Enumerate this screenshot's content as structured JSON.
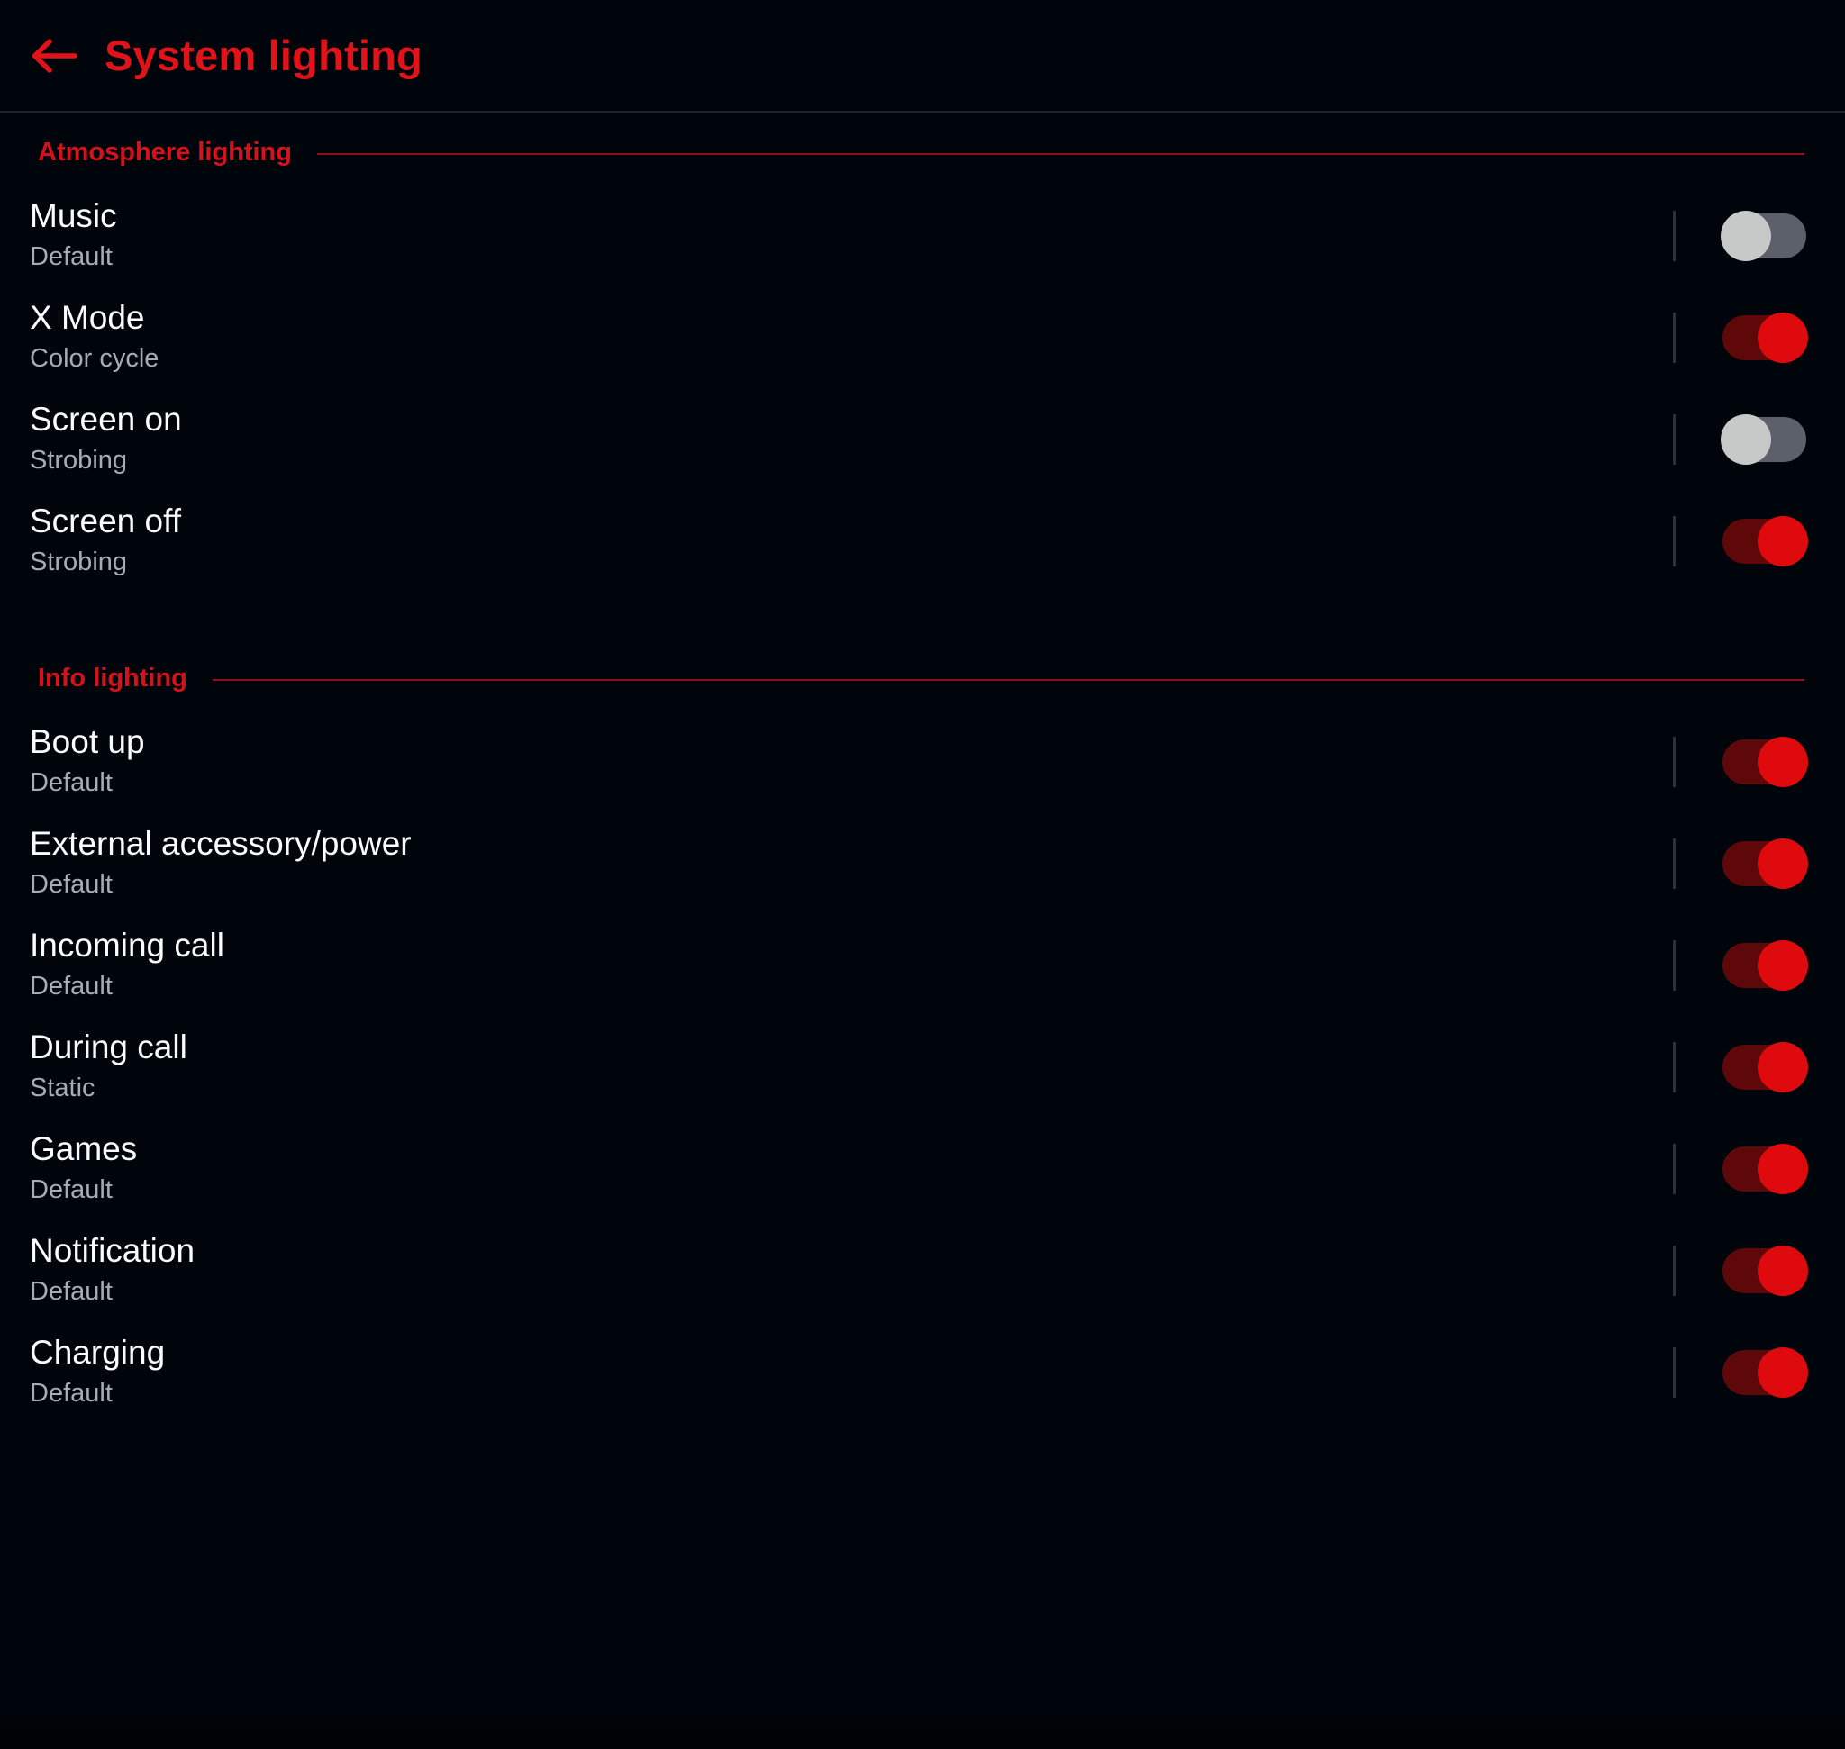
{
  "header": {
    "back_icon": "arrow-left-icon",
    "title": "System lighting"
  },
  "colors": {
    "background": "#00050b",
    "accent_red": "#e0131a",
    "section_label_red": "#d4121b",
    "section_rule_red": "#8c1218",
    "toggle_on_track": "#5e0809",
    "toggle_on_thumb": "#df0a0d",
    "toggle_off_track": "#5b606a",
    "toggle_off_thumb": "#c7c9c9",
    "title_text": "#fafbfc",
    "subtitle_text": "#a7acb4",
    "divider": "#1d2330"
  },
  "sections": [
    {
      "label": "Atmosphere lighting",
      "rows": [
        {
          "title": "Music",
          "subtitle": "Default",
          "toggle": "off"
        },
        {
          "title": "X Mode",
          "subtitle": "Color cycle",
          "toggle": "on"
        },
        {
          "title": "Screen on",
          "subtitle": "Strobing",
          "toggle": "off"
        },
        {
          "title": "Screen off",
          "subtitle": "Strobing",
          "toggle": "on"
        }
      ]
    },
    {
      "label": "Info lighting",
      "rows": [
        {
          "title": "Boot up",
          "subtitle": "Default",
          "toggle": "on"
        },
        {
          "title": "External accessory/power",
          "subtitle": "Default",
          "toggle": "on"
        },
        {
          "title": "Incoming call",
          "subtitle": "Default",
          "toggle": "on"
        },
        {
          "title": "During call",
          "subtitle": "Static",
          "toggle": "on"
        },
        {
          "title": "Games",
          "subtitle": "Default",
          "toggle": "on"
        },
        {
          "title": "Notification",
          "subtitle": "Default",
          "toggle": "on"
        },
        {
          "title": "Charging",
          "subtitle": "Default",
          "toggle": "on"
        }
      ]
    }
  ]
}
